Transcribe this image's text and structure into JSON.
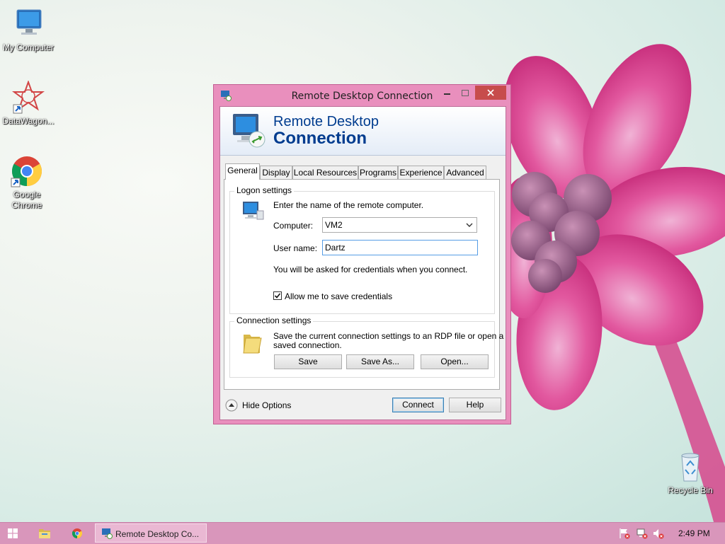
{
  "desktop": {
    "icons": [
      {
        "label": "My Computer"
      },
      {
        "label": "DataWagon..."
      },
      {
        "label": "Google Chrome"
      },
      {
        "label": "Recycle Bin"
      }
    ]
  },
  "window": {
    "title": "Remote Desktop Connection",
    "banner_line1": "Remote Desktop",
    "banner_line2": "Connection",
    "tabs": [
      {
        "label": "General"
      },
      {
        "label": "Display"
      },
      {
        "label": "Local Resources"
      },
      {
        "label": "Programs"
      },
      {
        "label": "Experience"
      },
      {
        "label": "Advanced"
      }
    ],
    "logon": {
      "title": "Logon settings",
      "instruction": "Enter the name of the remote computer.",
      "computer_label": "Computer:",
      "computer_value": "VM2",
      "username_label": "User name:",
      "username_value": "Dartz",
      "credentials_note": "You will be asked for credentials when you connect.",
      "save_credentials_label": "Allow me to save credentials",
      "save_credentials_checked": true
    },
    "connection": {
      "title": "Connection settings",
      "desc_line1": "Save the current connection settings to an RDP file or open a",
      "desc_line2": "saved connection.",
      "save_label": "Save",
      "save_as_label": "Save As...",
      "open_label": "Open..."
    },
    "footer": {
      "hide_options_label": "Hide Options",
      "connect_label": "Connect",
      "help_label": "Help"
    }
  },
  "taskbar": {
    "active_app_label": "Remote Desktop Co...",
    "clock": "2:49 PM"
  },
  "colors": {
    "window_frame": "#e98fbd",
    "taskbar": "#d996bb",
    "banner_text": "#003c8f",
    "close_button": "#c74c4c"
  }
}
